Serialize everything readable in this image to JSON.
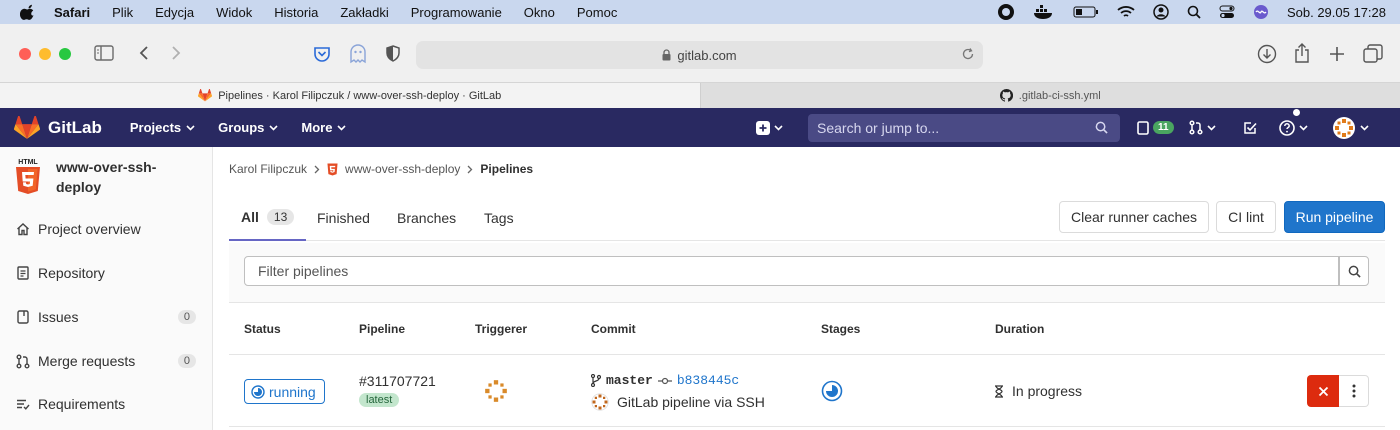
{
  "menubar": {
    "app": "Safari",
    "items": [
      "Plik",
      "Edycja",
      "Widok",
      "Historia",
      "Zakładki",
      "Programowanie",
      "Okno",
      "Pomoc"
    ],
    "clock": "Sob. 29.05  17:28"
  },
  "browser": {
    "url": "gitlab.com",
    "tabs": [
      {
        "title": "Pipelines · Karol Filipczuk / www-over-ssh-deploy · GitLab",
        "icon": "gitlab-icon",
        "active": true
      },
      {
        "title": ".gitlab-ci-ssh.yml",
        "icon": "github-icon",
        "active": false
      }
    ]
  },
  "header": {
    "brand": "GitLab",
    "nav": [
      "Projects",
      "Groups",
      "More"
    ],
    "search_placeholder": "Search or jump to...",
    "issues_count": "11"
  },
  "sidebar": {
    "project_name": "www-over-ssh-deploy",
    "items": [
      {
        "label": "Project overview",
        "icon": "home-icon"
      },
      {
        "label": "Repository",
        "icon": "doc-icon"
      },
      {
        "label": "Issues",
        "icon": "issues-icon",
        "count": "0"
      },
      {
        "label": "Merge requests",
        "icon": "merge-request-icon",
        "count": "0"
      },
      {
        "label": "Requirements",
        "icon": "requirements-icon"
      }
    ]
  },
  "breadcrumb": {
    "owner": "Karol Filipczuk",
    "project": "www-over-ssh-deploy",
    "current": "Pipelines"
  },
  "tabs": {
    "all": "All",
    "all_count": "13",
    "finished": "Finished",
    "branches": "Branches",
    "tags": "Tags"
  },
  "buttons": {
    "clear_caches": "Clear runner caches",
    "ci_lint": "CI lint",
    "run_pipeline": "Run pipeline"
  },
  "filter": {
    "placeholder": "Filter pipelines"
  },
  "table": {
    "headers": [
      "Status",
      "Pipeline",
      "Triggerer",
      "Commit",
      "Stages",
      "Duration"
    ],
    "rows": [
      {
        "status": "running",
        "pipeline_id": "#311707721",
        "tag": "latest",
        "branch": "master",
        "sha": "b838445c",
        "message": "GitLab pipeline via SSH",
        "duration": "In progress"
      }
    ]
  },
  "colors": {
    "header_bg": "#292961",
    "primary": "#1f75cb",
    "danger": "#dd2b0e"
  }
}
